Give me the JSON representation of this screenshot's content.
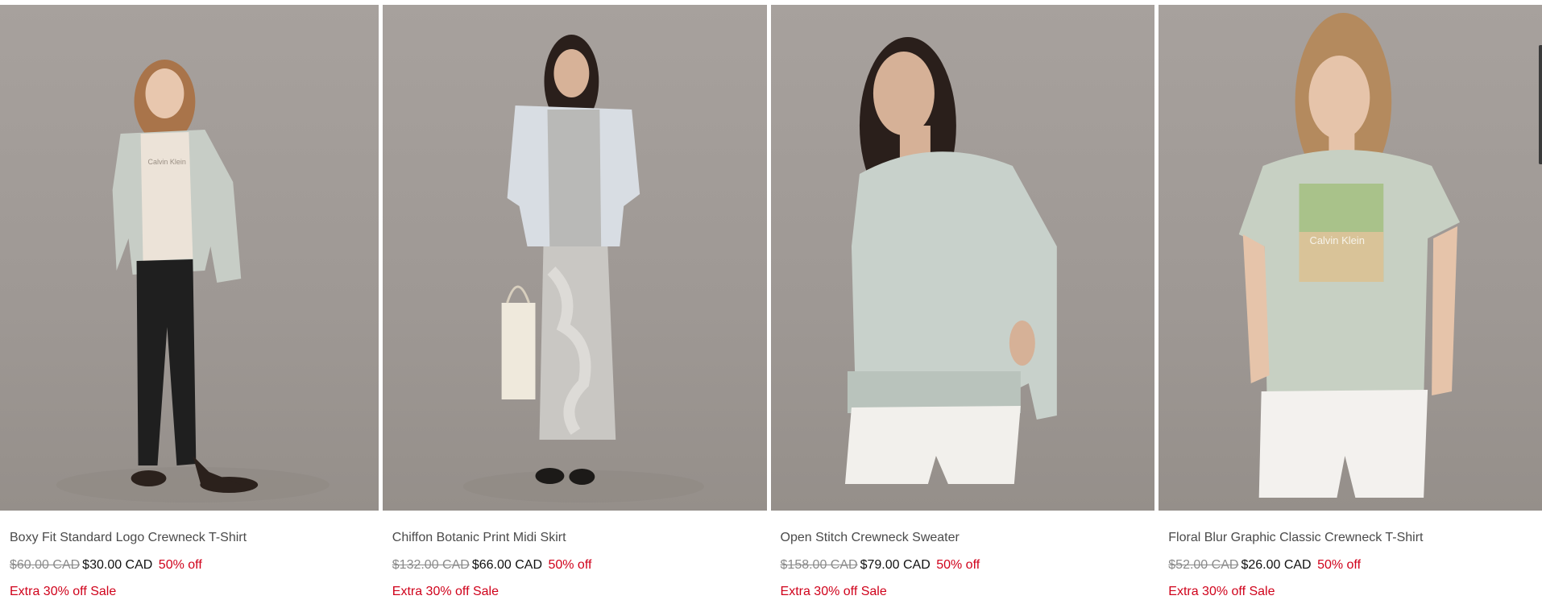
{
  "products": [
    {
      "name": "Boxy Fit Standard Logo Crewneck T-Shirt",
      "original_price": "$60.00 CAD",
      "sale_price": "$30.00 CAD",
      "discount": "50% off",
      "promo": "Extra 30% off Sale",
      "shirt_print": "Calvin Klein"
    },
    {
      "name": "Chiffon Botanic Print Midi Skirt",
      "original_price": "$132.00 CAD",
      "sale_price": "$66.00 CAD",
      "discount": "50% off",
      "promo": "Extra 30% off Sale"
    },
    {
      "name": "Open Stitch Crewneck Sweater",
      "original_price": "$158.00 CAD",
      "sale_price": "$79.00 CAD",
      "discount": "50% off",
      "promo": "Extra 30% off Sale"
    },
    {
      "name": "Floral Blur Graphic Classic Crewneck T-Shirt",
      "original_price": "$52.00 CAD",
      "sale_price": "$26.00 CAD",
      "discount": "50% off",
      "promo": "Extra 30% off Sale",
      "shirt_print": "Calvin Klein"
    }
  ],
  "colors": {
    "sale_red": "#d0021b",
    "strike_gray": "#8a8a8a",
    "name_gray": "#4a4a4a"
  }
}
